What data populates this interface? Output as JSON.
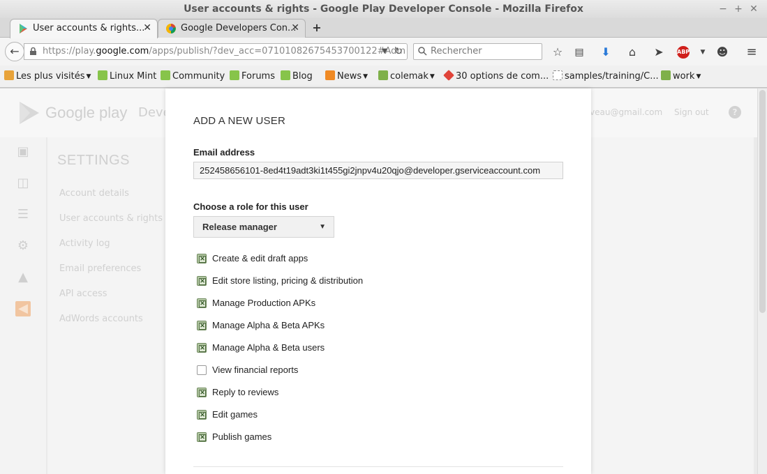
{
  "window": {
    "title": "User accounts & rights - Google Play Developer Console - Mozilla Firefox",
    "controls": {
      "minimize": "−",
      "maximize": "+",
      "close": "✕"
    }
  },
  "tabs": [
    {
      "label": "User accounts & rights...",
      "active": true,
      "icon": "google-play-icon"
    },
    {
      "label": "Google Developers Con...",
      "active": false,
      "icon": "google-developers-icon"
    }
  ],
  "navbar": {
    "url_prefix": "https://play.",
    "url_domain": "google.com",
    "url_rest": "/apps/publish/?dev_acc=07101082675453700122#Adm",
    "search_placeholder": "Rechercher"
  },
  "bookmarks": [
    {
      "label": "Les plus visités",
      "icon": "folder-icon",
      "dropdown": true,
      "color": "#e8a33a"
    },
    {
      "label": "Linux Mint",
      "icon": "mint-icon",
      "dropdown": false,
      "color": "#87c44a"
    },
    {
      "label": "Community",
      "icon": "mint-icon",
      "dropdown": false,
      "color": "#87c44a"
    },
    {
      "label": "Forums",
      "icon": "mint-icon",
      "dropdown": false,
      "color": "#87c44a"
    },
    {
      "label": "Blog",
      "icon": "mint-icon",
      "dropdown": false,
      "color": "#87c44a"
    },
    {
      "label": "News",
      "icon": "rss-icon",
      "dropdown": true,
      "color": "#f08a24"
    },
    {
      "label": "colemak",
      "icon": "folder-icon",
      "dropdown": true,
      "color": "#7fb04a"
    },
    {
      "label": "30 options de com...",
      "icon": "git-icon",
      "dropdown": false,
      "color": "#e0443a"
    },
    {
      "label": "samples/training/C...",
      "icon": "page-icon",
      "dropdown": false,
      "color": "#ffffff"
    },
    {
      "label": "work",
      "icon": "folder-icon",
      "dropdown": true,
      "color": "#7fb04a"
    }
  ],
  "background_page": {
    "brand": "Google play",
    "brand_suffix": "Deve",
    "email_fragment": "veau@gmail.com",
    "sign_out": "Sign out",
    "help": "?",
    "settings_title": "SETTINGS",
    "settings_nav": [
      "Account details",
      "User accounts & rights",
      "Activity log",
      "Email preferences",
      "API access",
      "AdWords accounts"
    ]
  },
  "modal": {
    "title": "ADD A NEW USER",
    "email_label": "Email address",
    "email_value": "252458656101-8ed4t19adt3ki1t455gi2jnpv4u20qjo@developer.gserviceaccount.com",
    "role_label": "Choose a role for this user",
    "role_selected": "Release manager",
    "permissions": [
      {
        "label": "Create & edit draft apps",
        "checked": true
      },
      {
        "label": "Edit store listing, pricing & distribution",
        "checked": true
      },
      {
        "label": "Manage Production APKs",
        "checked": true
      },
      {
        "label": "Manage Alpha & Beta APKs",
        "checked": true
      },
      {
        "label": "Manage Alpha & Beta users",
        "checked": true
      },
      {
        "label": "View financial reports",
        "checked": false
      },
      {
        "label": "Reply to reviews",
        "checked": true
      },
      {
        "label": "Edit games",
        "checked": true
      },
      {
        "label": "Publish games",
        "checked": true
      }
    ]
  }
}
